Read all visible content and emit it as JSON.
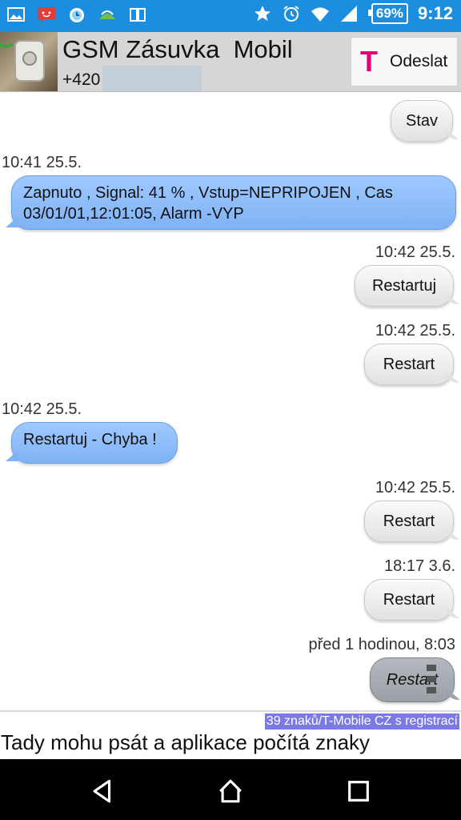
{
  "status_bar": {
    "battery": "69%",
    "time": "9:12",
    "icons": [
      "image-icon",
      "sms-notification-icon",
      "alarm-clock-app-icon",
      "weather-icon",
      "book-icon",
      "star-icon",
      "alarm-icon",
      "wifi-icon",
      "signal-icon",
      "battery-icon"
    ]
  },
  "header": {
    "contact_name": "GSM Zásuvka  Mobil",
    "contact_number": "+420",
    "send_label": "Odeslat",
    "carrier_logo": "T"
  },
  "messages": [
    {
      "direction": "out",
      "text": "Stav",
      "timestamp": ""
    },
    {
      "direction": "in",
      "text": "Zapnuto , Signal: 41 % , Vstup=NEPRIPOJEN , Cas 03/01/01,12:01:05, Alarm -VYP",
      "timestamp": "10:41 25.5."
    },
    {
      "direction": "out",
      "text": "Restartuj",
      "timestamp": "10:42 25.5."
    },
    {
      "direction": "out",
      "text": "Restart",
      "timestamp": "10:42 25.5."
    },
    {
      "direction": "in",
      "text": "Restartuj - Chyba !",
      "timestamp": "10:42 25.5."
    },
    {
      "direction": "out",
      "text": "Restart",
      "timestamp": "10:42 25.5."
    },
    {
      "direction": "out",
      "text": "Restart",
      "timestamp": "18:17 3.6."
    },
    {
      "direction": "out",
      "text": "Restart",
      "timestamp": "před 1 hodinou, 8:03",
      "status": "pending"
    }
  ],
  "composer": {
    "counter": "39 znaků/T-Mobile CZ s registrací",
    "text": "Tady mohu psát a aplikace počítá znaky"
  },
  "colors": {
    "status_bar": "#1c8ee0",
    "incoming_bubble": "#8fbdfa",
    "outgoing_bubble": "#eeeeee",
    "pending_bubble": "#a7adb3",
    "carrier_accent": "#e20074",
    "counter_bg": "#7b79e6"
  }
}
